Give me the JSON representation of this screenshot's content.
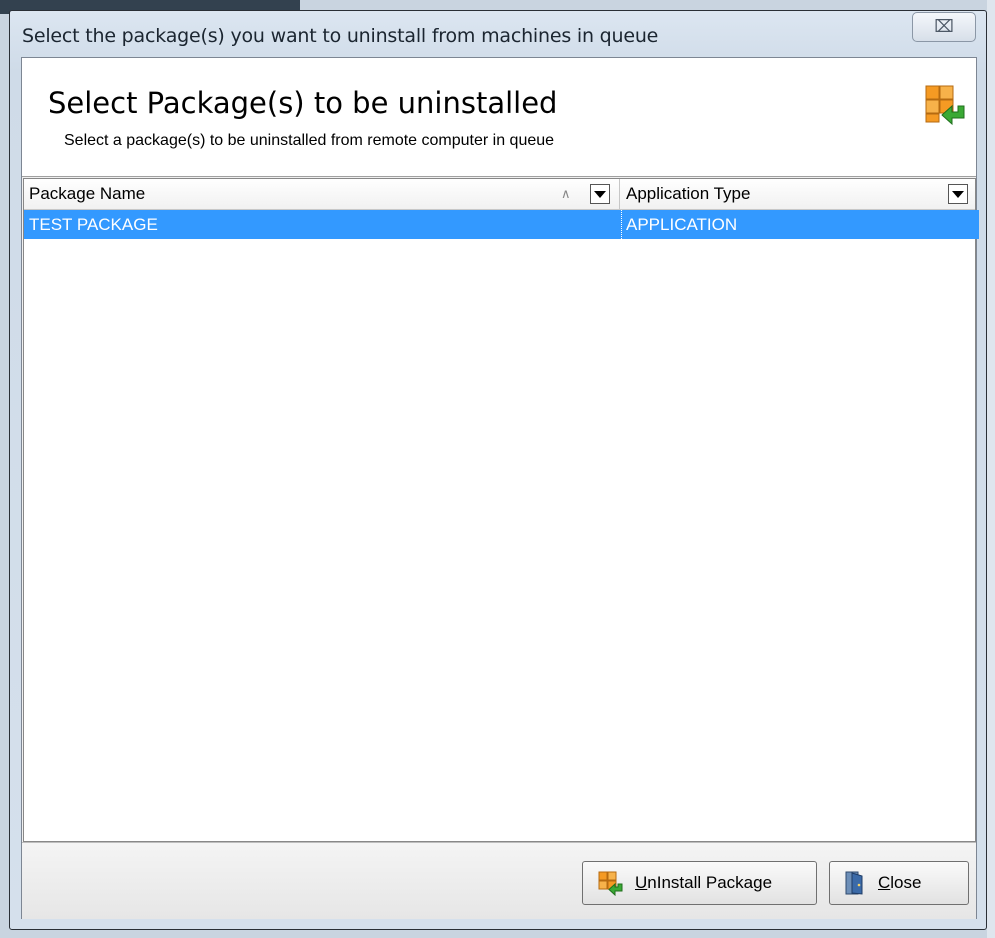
{
  "window": {
    "title": "Select the package(s) you want to uninstall from machines in queue",
    "close_glyph": "⌧"
  },
  "header": {
    "title": "Select Package(s) to be uninstalled",
    "subtitle": "Select a package(s) to be uninstalled from remote computer in queue",
    "icon": "package-uninstall-icon"
  },
  "grid": {
    "columns": [
      {
        "label": "Package Name",
        "sort": "ascending"
      },
      {
        "label": "Application Type"
      }
    ],
    "sort_glyph": "∧",
    "rows": [
      {
        "name": "TEST PACKAGE",
        "type": "APPLICATION",
        "selected": true
      }
    ]
  },
  "footer": {
    "uninstall_button": {
      "mnemonic": "U",
      "rest": "nInstall Package",
      "icon": "package-uninstall-icon"
    },
    "close_button": {
      "mnemonic": "C",
      "rest": "lose",
      "icon": "door-exit-icon"
    }
  },
  "colors": {
    "selection": "#3399ff",
    "package_orange": "#f59a23",
    "arrow_green": "#3aa935"
  }
}
